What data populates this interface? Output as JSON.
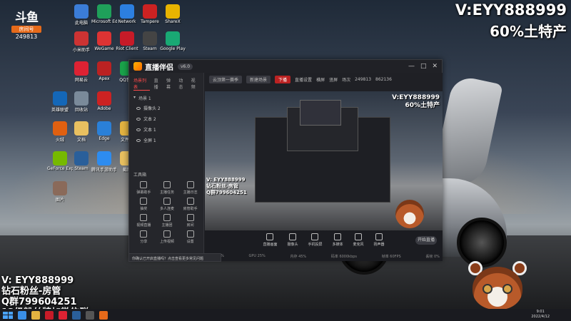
{
  "brand": {
    "name": "斗鱼",
    "badge": "房间号",
    "room": "249813"
  },
  "overlay": {
    "top_line1": "V:EYY888999",
    "top_line2": "60%土特产",
    "left_lines": [
      "V: EYY888999",
      "钻石粉丝-房管",
      "Q群799604251",
      "12级粉丝牌加微信群"
    ]
  },
  "desktop_icons": [
    {
      "label": "此电脑",
      "color": "#3b7dd8"
    },
    {
      "label": "Microsoft Edge",
      "color": "#1fa05a"
    },
    {
      "label": "Network",
      "color": "#2c7fe0"
    },
    {
      "label": "Tampere",
      "color": "#c22"
    },
    {
      "label": "ShareX",
      "color": "#e8b400"
    },
    {
      "label": "小米助手",
      "color": "#c33"
    },
    {
      "label": "WeGame",
      "color": "#d33"
    },
    {
      "label": "Riot Client",
      "color": "#c61b28"
    },
    {
      "label": "Steam",
      "color": "#444"
    },
    {
      "label": "Google Play",
      "color": "#19a974"
    },
    {
      "label": "网易云",
      "color": "#d23"
    },
    {
      "label": "Apex",
      "color": "#b22"
    },
    {
      "label": "QQ音乐",
      "color": "#1aa34a"
    },
    {
      "label": "英雄联盟",
      "color": "#1467b8"
    },
    {
      "label": "回收站",
      "color": "#7a8a9a"
    },
    {
      "label": "Adobe",
      "color": "#c22"
    },
    {
      "label": "火绒",
      "color": "#e06010"
    },
    {
      "label": "文档",
      "color": "#e8c060"
    },
    {
      "label": "Edge",
      "color": "#2a80d8"
    },
    {
      "label": "文件夹",
      "color": "#e3b341"
    },
    {
      "label": "GeForce Experience",
      "color": "#76b900"
    },
    {
      "label": "Steam",
      "color": "#2a5f9a"
    },
    {
      "label": "腾讯手游助手",
      "color": "#2d8cf0"
    },
    {
      "label": "截图",
      "color": "#e8c060"
    },
    {
      "label": "图片",
      "color": "#8a6a5a"
    }
  ],
  "window": {
    "title": "直播伴侣",
    "version": "v6.0",
    "tabs": [
      "场景列表",
      "直播",
      "弹幕",
      "动态",
      "视频"
    ],
    "scene_label": "场景 1",
    "sources": [
      "摄像头 2",
      "文本 2",
      "文本 1",
      "全屏 1"
    ],
    "tools_title": "工具箱",
    "tools": [
      "弹幕助手",
      "主播任务",
      "主播日志",
      "抽奖",
      "多人连麦",
      "房管助手",
      "视频直播",
      "主播团",
      "房间",
      "分享",
      "上传视频",
      "设置"
    ],
    "canvas_bar": [
      "云顶第一赛季",
      "新建场景",
      "下播",
      "直播设置",
      "横屏",
      "竖屏",
      "场次",
      "249813",
      "862136"
    ],
    "bottom_buttons": [
      "直播画面",
      "摄像头",
      "手机投屏",
      "多媒体",
      "麦克风",
      "扬声器"
    ],
    "live_button": "开始直播",
    "stats": [
      "CPU 10%",
      "GPU 25%",
      "内存 45%",
      "码率 6000kbps",
      "帧率 60FPS",
      "丢帧 0%"
    ],
    "notice": "你确认已开启直播吗？点击查看更多常见问题"
  },
  "preview": {
    "text_top1": "V:EYY888999",
    "text_top2": "60%土特产",
    "text_left": [
      "V: EYY888999",
      "钻石粉丝-房管",
      "Q群799604251"
    ]
  },
  "taskbar": {
    "apps": [
      {
        "name": "chrome",
        "color": "#3a8ee6"
      },
      {
        "name": "folder",
        "color": "#e3b341"
      },
      {
        "name": "riot",
        "color": "#c61b28"
      },
      {
        "name": "netease",
        "color": "#d23"
      },
      {
        "name": "steam",
        "color": "#2a5f9a"
      },
      {
        "name": "obs",
        "color": "#555"
      },
      {
        "name": "douyu",
        "color": "#e66a1a"
      }
    ],
    "time": "9:01",
    "date": "2022/4/12"
  }
}
